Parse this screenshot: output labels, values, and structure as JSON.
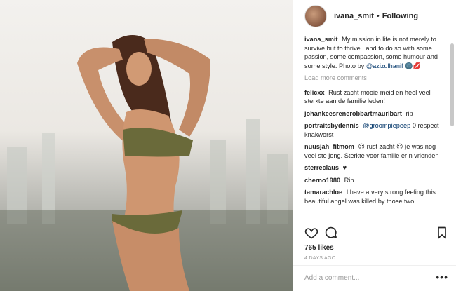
{
  "header": {
    "username": "ivana_smit",
    "separator": "•",
    "follow_status": "Following"
  },
  "caption": {
    "username": "ivana_smit",
    "text": "My mission in life is not merely to survive but to thrive ; and to do so with some passion, some compassion, some humour and some style. Photo by",
    "mention": "@azizulhanif",
    "emoji": "🌚💋"
  },
  "load_more": "Load more comments",
  "comments": [
    {
      "user": "felicxx",
      "text": "Rust zacht mooie meid en heel veel sterkte aan de familie leden!"
    },
    {
      "user": "johankeesrenerobbartmauribart",
      "text": "rip"
    },
    {
      "user": "portraitsbydennis",
      "mention": "@groompiepeep",
      "text": "0 respect knakworst"
    },
    {
      "user": "nuusjah_fitmom",
      "text": "☹ rust zacht ☹ je was nog veel ste jong. Sterkte voor familie er n vrienden"
    },
    {
      "user": "sterreclaus",
      "text": "♥"
    },
    {
      "user": "cherno1980",
      "text": "Rip"
    },
    {
      "user": "tamarachloe",
      "text": "I have a very strong feeling this beautiful angel was killed by those two"
    }
  ],
  "likes": "765 likes",
  "time_ago": "4 DAYS AGO",
  "add_comment_placeholder": "Add a comment...",
  "more_options": "•••",
  "icons": [
    "heart-icon",
    "comment-icon",
    "bookmark-icon"
  ]
}
